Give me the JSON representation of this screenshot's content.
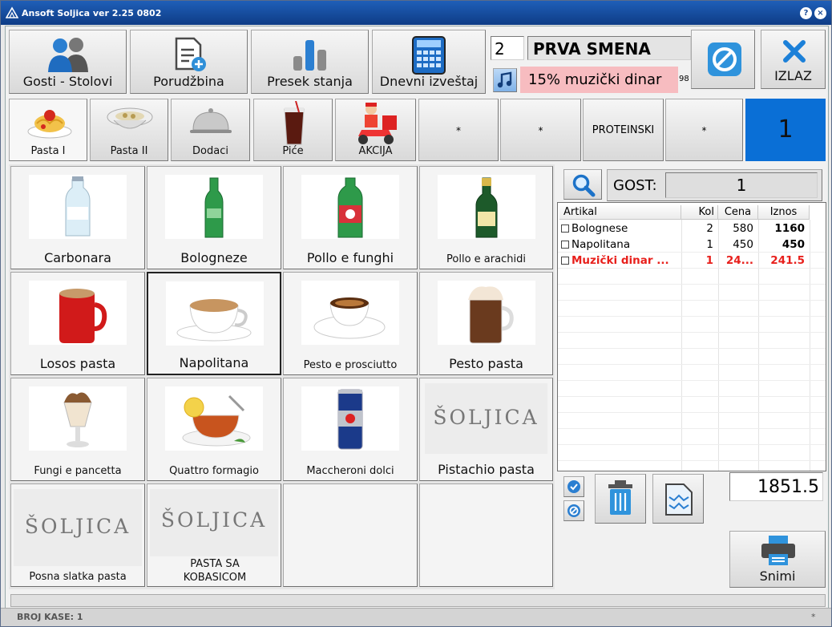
{
  "window": {
    "title": "Ansoft Soljica ver 2.25 0802",
    "help": "?",
    "close": "×"
  },
  "toolbar": [
    {
      "label": "Gosti - Stolovi",
      "icon": "users-icon"
    },
    {
      "label": "Porudžbina",
      "icon": "new-order-icon"
    },
    {
      "label": "Presek stanja",
      "icon": "bar-chart-icon"
    },
    {
      "label": "Dnevni izveštaj",
      "icon": "calculator-icon"
    }
  ],
  "shift": {
    "number": "2",
    "name": "PRVA SMENA",
    "music_text": "15% muzički dinar",
    "small_number": "98"
  },
  "exit_label": "IZLAZ",
  "categories": [
    {
      "label": "Pasta I",
      "icon": "spaghetti-icon"
    },
    {
      "label": "Pasta II",
      "icon": "soup-bowl-icon"
    },
    {
      "label": "Dodaci",
      "icon": "cloche-icon"
    },
    {
      "label": "Piće",
      "icon": "cola-glass-icon"
    },
    {
      "label": "AKCIJA",
      "icon": "delivery-scooter-icon"
    },
    {
      "label": "*"
    },
    {
      "label": "*"
    },
    {
      "label": "PROTEINSKI"
    },
    {
      "label": "*"
    }
  ],
  "table_number": "1",
  "products": [
    {
      "label": "Carbonara",
      "icon": "water-bottle-icon"
    },
    {
      "label": "Bologneze",
      "icon": "green-bottle-icon"
    },
    {
      "label": "Pollo e funghi",
      "icon": "mineral-water-icon"
    },
    {
      "label": "Pollo e arachidi",
      "icon": "beer-bottle-icon"
    },
    {
      "label": "Losos pasta",
      "icon": "nescafe-mug-icon"
    },
    {
      "label": "Napolitana",
      "icon": "cappuccino-cup-icon"
    },
    {
      "label": "Pesto e prosciutto",
      "icon": "espresso-cup-icon"
    },
    {
      "label": "Pesto pasta",
      "icon": "hot-chocolate-icon"
    },
    {
      "label": "Fungi e pancetta",
      "icon": "ice-cream-cup-icon"
    },
    {
      "label": "Quattro formagio",
      "icon": "tea-cup-icon"
    },
    {
      "label": "Maccheroni dolci",
      "icon": "energy-can-icon"
    },
    {
      "label": "Pistachio pasta",
      "logo": "ŠOLJICA"
    },
    {
      "label": "Posna slatka pasta",
      "logo": "ŠOLJICA"
    },
    {
      "label": "PASTA SA KOBASICOM",
      "logo": "ŠOLJICA"
    }
  ],
  "guest": {
    "label": "GOST:",
    "value": "1"
  },
  "order_table": {
    "headers": [
      "Artikal",
      "Kol",
      "Cena",
      "Iznos"
    ],
    "rows": [
      {
        "name": "Bolognese",
        "qty": "2",
        "price": "580",
        "amount": "1160",
        "red": false
      },
      {
        "name": "Napolitana",
        "qty": "1",
        "price": "450",
        "amount": "450",
        "red": false
      },
      {
        "name": "Muzički dinar ...",
        "qty": "1",
        "price": "24...",
        "amount": "241.5",
        "red": true
      }
    ]
  },
  "total": "1851.5",
  "save_label": "Snimi",
  "status": {
    "text": "BROJ KASE: 1",
    "right": "*"
  },
  "colors": {
    "title": "#1545a0",
    "accent_blue": "#0a6fd6",
    "pink": "#f7bcc0",
    "red": "#e8201c"
  }
}
